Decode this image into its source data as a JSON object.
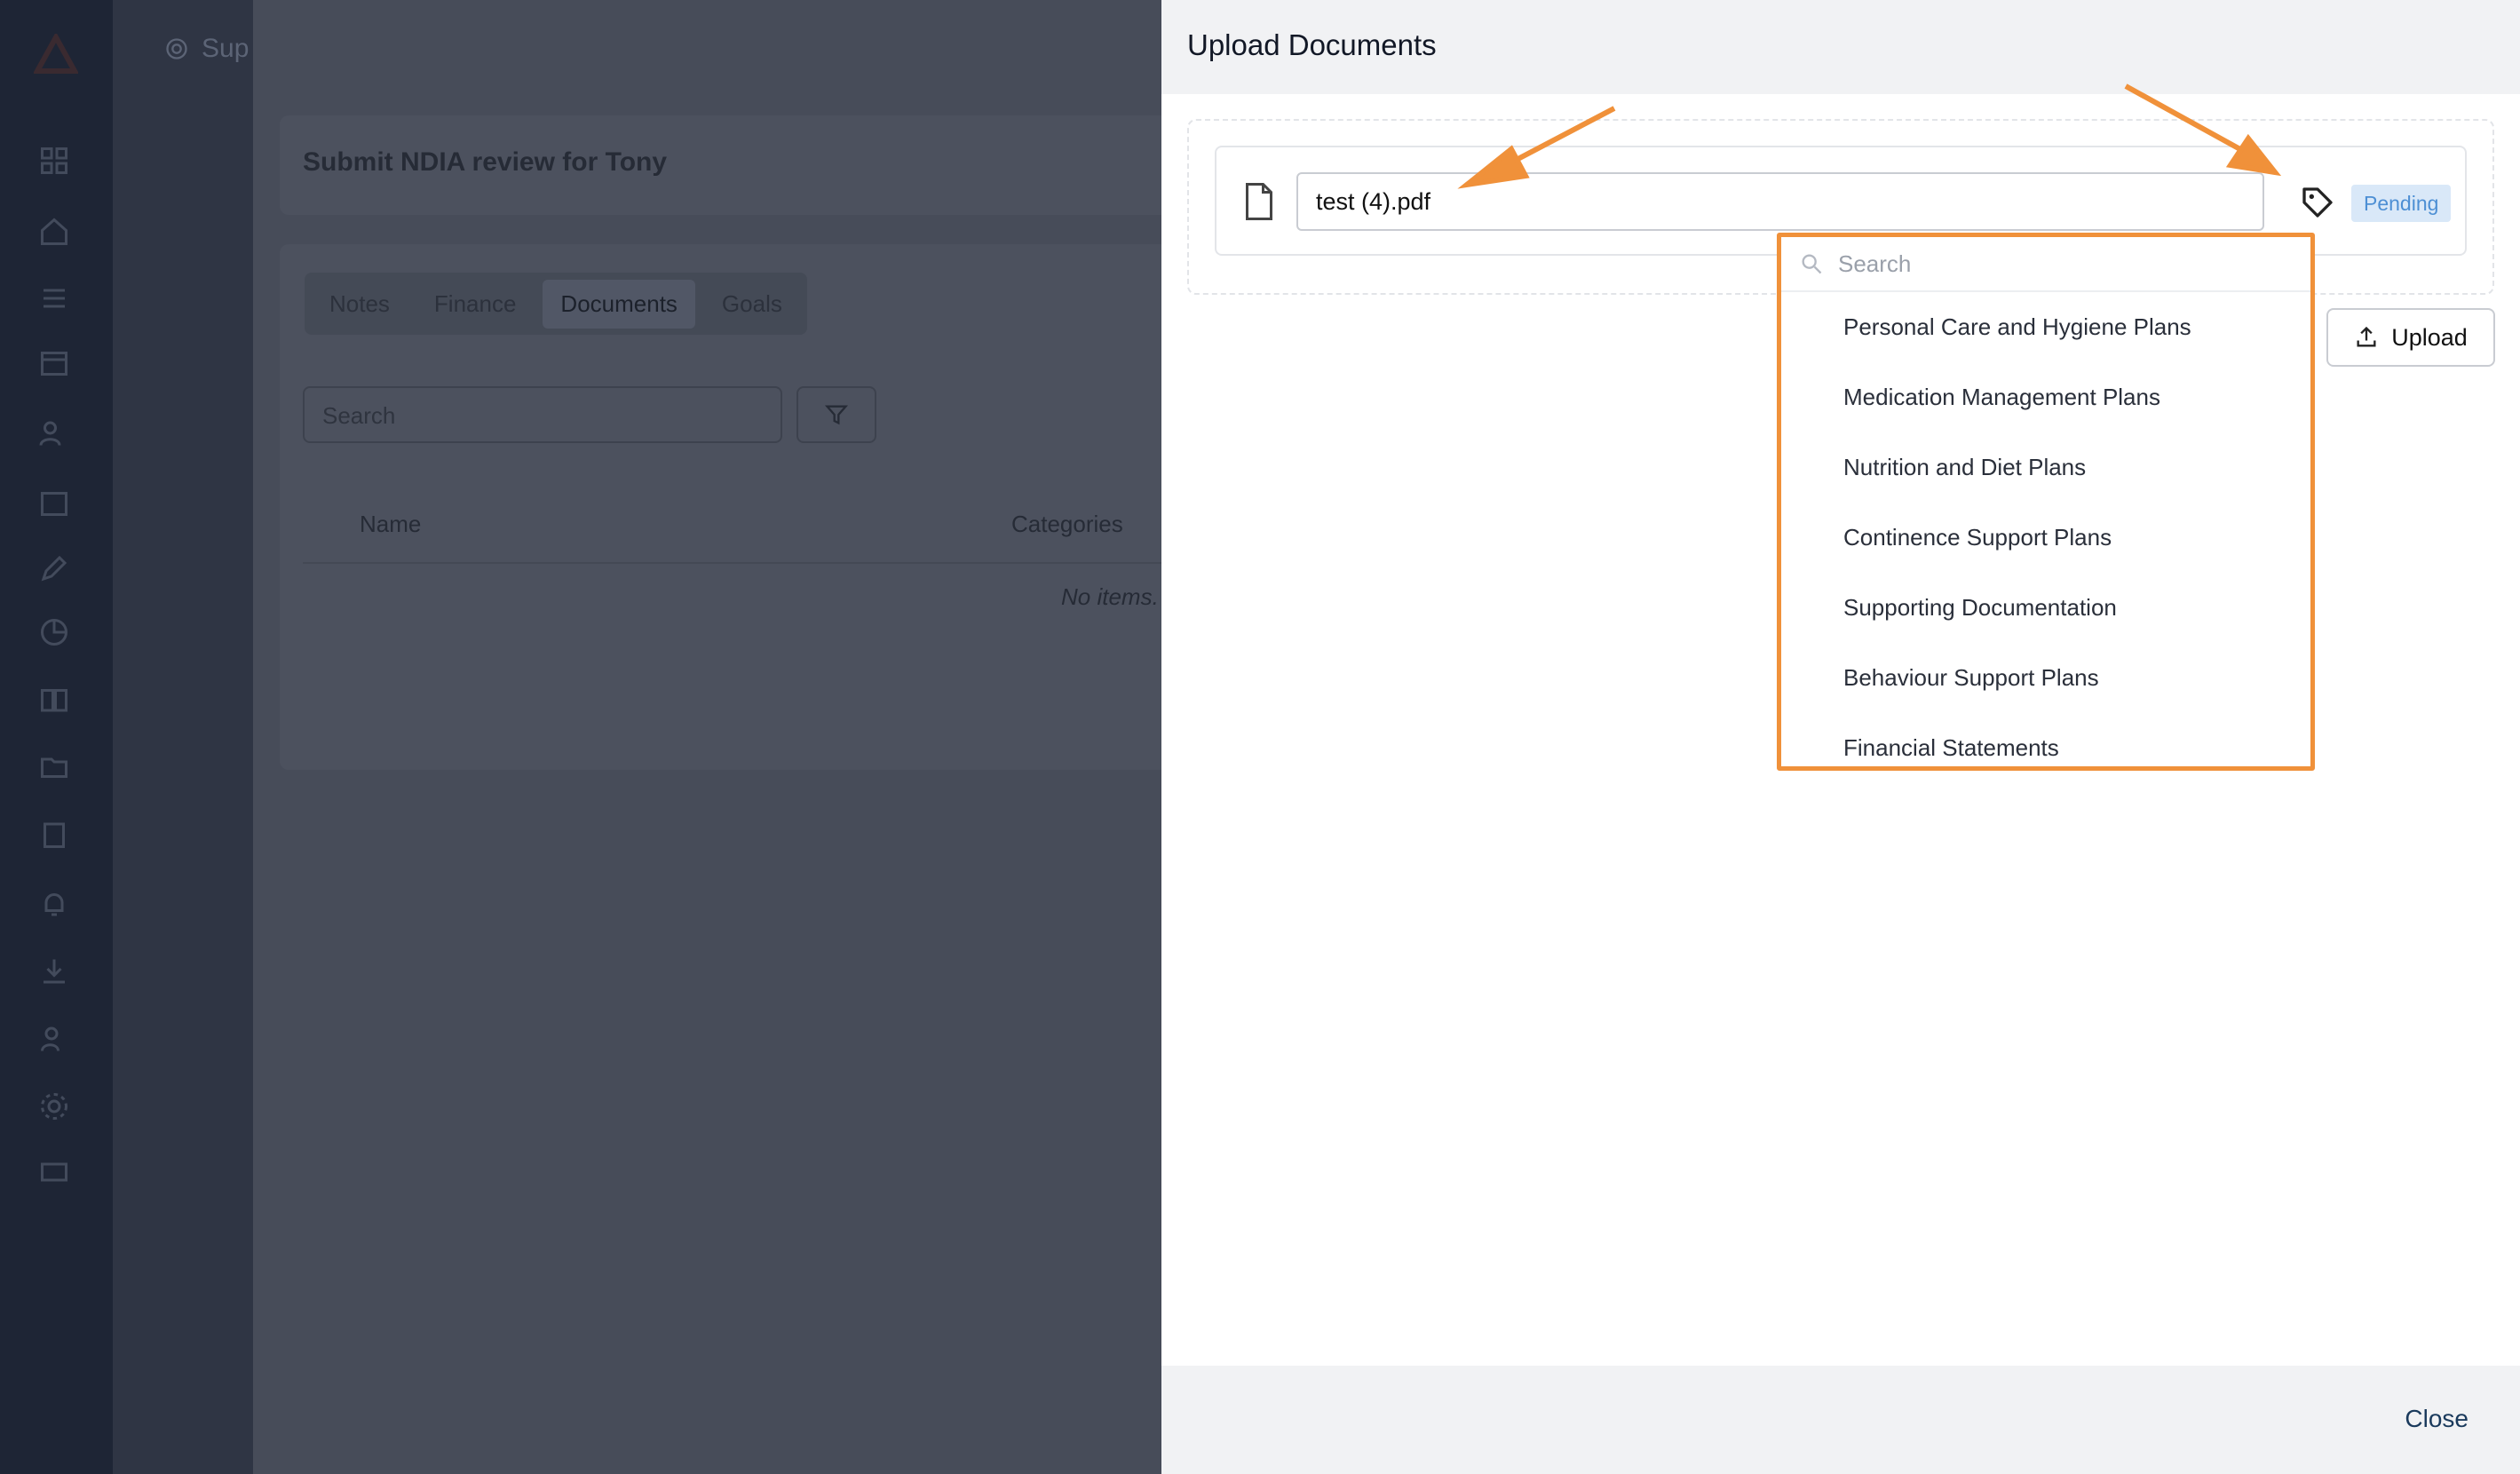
{
  "background": {
    "subnav_label": "Sup",
    "page_title": "Submit NDIA review for Tony",
    "tabs": [
      "Notes",
      "Finance",
      "Documents",
      "Goals"
    ],
    "active_tab": "Documents",
    "search_placeholder": "Search",
    "table": {
      "columns": [
        "Name",
        "Categories"
      ],
      "empty_text": "No items."
    }
  },
  "drawer": {
    "title": "Upload Documents",
    "file": {
      "name": "test (4).pdf",
      "status": "Pending"
    },
    "upload_label": "Upload",
    "close_label": "Close"
  },
  "category_dropdown": {
    "search_placeholder": "Search",
    "options": [
      "Personal Care and Hygiene Plans",
      "Medication Management Plans",
      "Nutrition and Diet Plans",
      "Continence Support Plans",
      "Supporting Documentation",
      "Behaviour Support Plans",
      "Financial Statements"
    ]
  },
  "colors": {
    "annotation": "#f0913a",
    "status_bg": "#d9e8f8",
    "status_text": "#4d8fd4"
  }
}
